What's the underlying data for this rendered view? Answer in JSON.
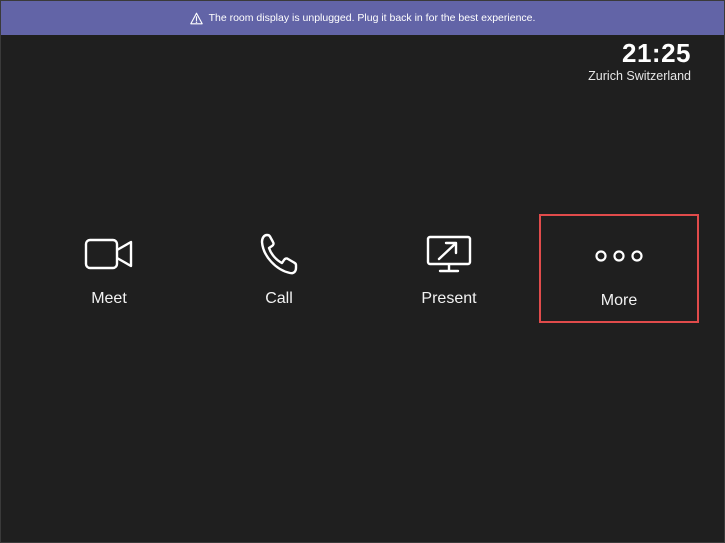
{
  "banner": {
    "message": "The room display is unplugged. Plug it back in for the best experience.",
    "icon": "warning-icon",
    "background": "#6264a7"
  },
  "clock": {
    "time": "21:25",
    "location": "Zurich Switzerland"
  },
  "actions": [
    {
      "label": "Meet",
      "icon": "video-camera-icon"
    },
    {
      "label": "Call",
      "icon": "phone-icon"
    },
    {
      "label": "Present",
      "icon": "share-screen-icon"
    },
    {
      "label": "More",
      "icon": "more-icon",
      "selected": true
    }
  ],
  "colors": {
    "background": "#1f1f1f",
    "selection_outline": "#e04b4b"
  }
}
